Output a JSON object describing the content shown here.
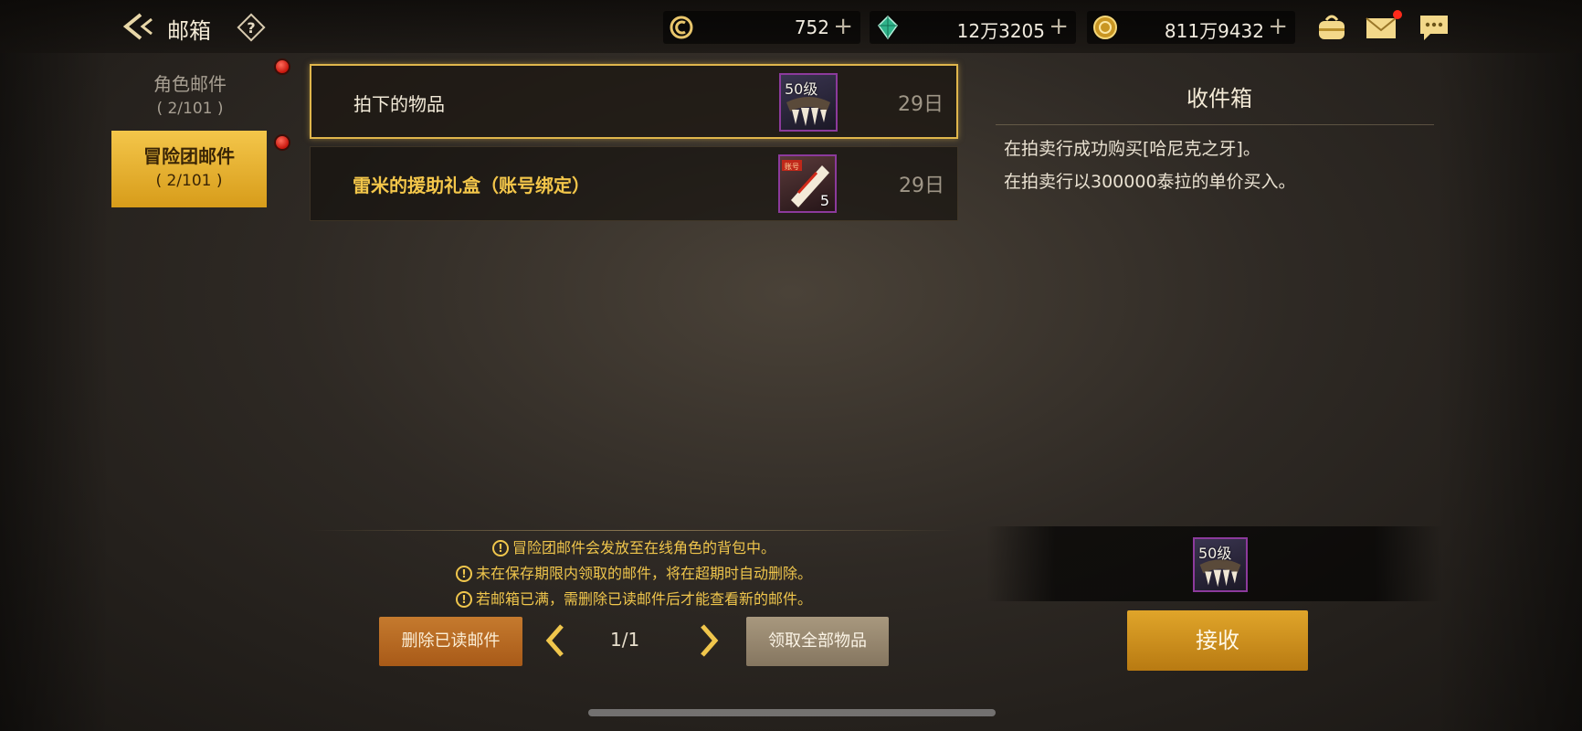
{
  "header": {
    "title": "邮箱",
    "help_label": "?"
  },
  "currencies": [
    {
      "name": "coin",
      "value": "752",
      "plus": "+"
    },
    {
      "name": "gem",
      "value": "12万3205",
      "plus": "+"
    },
    {
      "name": "gold",
      "value": "811万9432",
      "plus": "+"
    }
  ],
  "tabs": [
    {
      "name": "角色邮件",
      "count": "( 2/101 )"
    },
    {
      "name": "冒险团邮件",
      "count": "( 2/101 )"
    }
  ],
  "mails": [
    {
      "title": "拍下的物品",
      "item_level": "50级",
      "date": "29日"
    },
    {
      "title": "雷米的援助礼盒（账号绑定）",
      "item_badge": "账号",
      "item_count": "5",
      "date": "29日"
    }
  ],
  "notices": [
    "冒险团邮件会发放至在线角色的背包中。",
    "未在保存期限内领取的邮件，将在超期时自动删除。",
    "若邮箱已满，需删除已读邮件后才能查看新的邮件。"
  ],
  "controls": {
    "delete_read": "删除已读邮件",
    "page": "1/1",
    "claim_all": "领取全部物品"
  },
  "detail": {
    "title": "收件箱",
    "lines": [
      "在拍卖行成功购买[哈尼克之牙]。",
      "在拍卖行以300000泰拉的单价买入。"
    ],
    "attachment_level": "50级",
    "receive": "接收"
  },
  "colors": {
    "accent_gold": "#e0b64c",
    "notice_text": "#f0c64c",
    "delete_button": "#b8691f",
    "receive_button": "#cf9120"
  }
}
